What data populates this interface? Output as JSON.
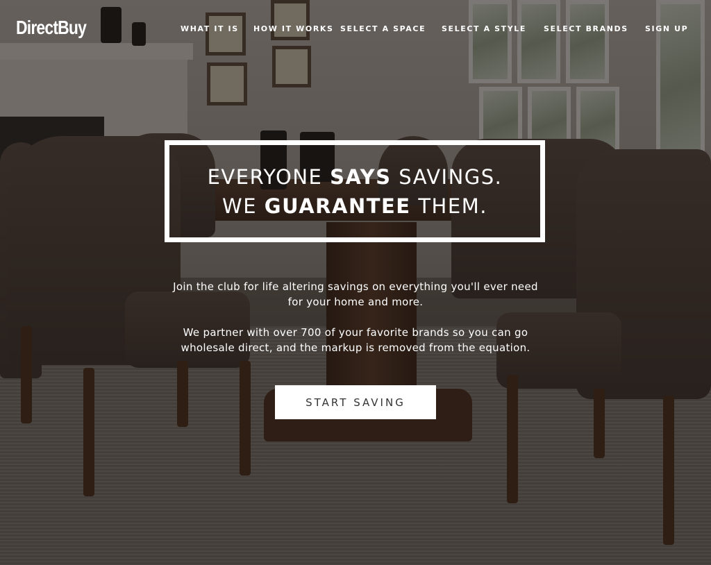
{
  "brand": {
    "logo_text": "DirectBuy"
  },
  "nav": {
    "items": [
      {
        "label": "WHAT IT IS"
      },
      {
        "label": "HOW IT WORKS"
      },
      {
        "label": "SELECT A SPACE"
      },
      {
        "label": "SELECT A STYLE"
      },
      {
        "label": "SELECT BRANDS"
      },
      {
        "label": "SIGN UP"
      }
    ]
  },
  "hero": {
    "headline": {
      "line1": {
        "pre": "EVERYONE ",
        "bold": "SAYS",
        "post": " SAVINGS."
      },
      "line2": {
        "pre": "WE ",
        "bold": "GUARANTEE",
        "post": " THEM."
      }
    },
    "paragraph1_line1": "Join the club for life altering savings on everything you'll ever need",
    "paragraph1_line2": "for your home and more.",
    "paragraph2_line1": "We partner with over 700 of your favorite brands so you can go",
    "paragraph2_line2": "wholesale direct, and the markup is removed from the equation.",
    "cta_label": "START SAVING"
  },
  "colors": {
    "text": "#ffffff",
    "cta_background": "#ffffff",
    "cta_text": "#333333",
    "overlay": "#120e0c"
  }
}
